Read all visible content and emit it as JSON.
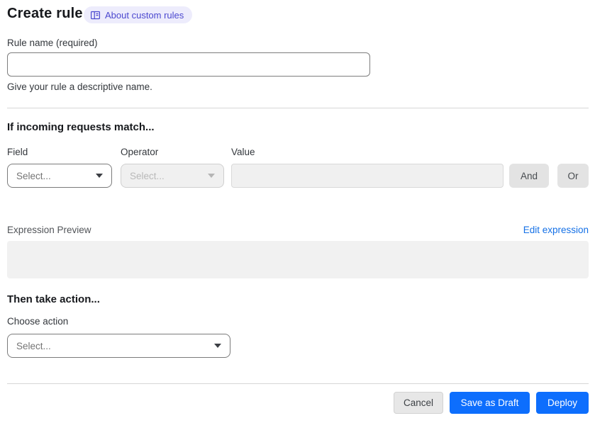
{
  "page": {
    "title": "Create rule"
  },
  "badge": {
    "label": "About custom rules",
    "icon": "book-icon",
    "bg_color": "#edecfc",
    "text_color": "#4b48cf"
  },
  "rule_name": {
    "label": "Rule name (required)",
    "value": "",
    "placeholder": "",
    "helper": "Give your rule a descriptive name."
  },
  "match_section": {
    "heading": "If incoming requests match...",
    "field": {
      "label": "Field",
      "selected": "Select...",
      "disabled": false
    },
    "operator": {
      "label": "Operator",
      "selected": "Select...",
      "disabled": true
    },
    "value": {
      "label": "Value",
      "value": "",
      "disabled": true
    },
    "and_button": "And",
    "or_button": "Or"
  },
  "expression": {
    "label": "Expression Preview",
    "edit_link": "Edit expression",
    "content": ""
  },
  "action_section": {
    "heading": "Then take action...",
    "choose_label": "Choose action",
    "select": {
      "selected": "Select...",
      "disabled": false
    }
  },
  "footer": {
    "cancel": "Cancel",
    "save_draft": "Save as Draft",
    "deploy": "Deploy",
    "primary_color": "#0d6efd"
  }
}
